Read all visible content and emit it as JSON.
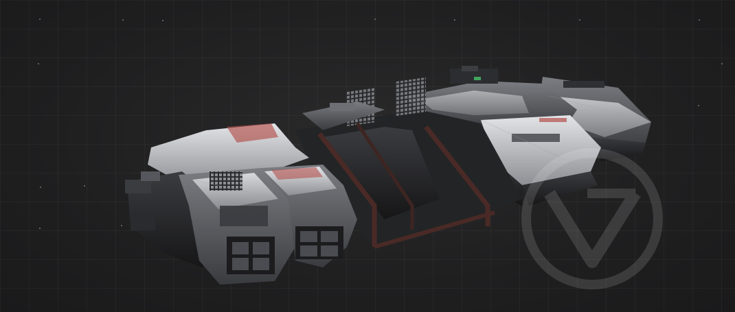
{
  "scene": {
    "subject": "spaceship-model",
    "background_color": "#1f1f20",
    "hull_colors": {
      "dark": "#2b2c2f",
      "mid": "#4a4c51",
      "light": "#c9cacd",
      "frame_rust": "#4a2a26",
      "accent_red": "#b2504c"
    },
    "watermark_icon": "circle-v-logo-icon"
  }
}
